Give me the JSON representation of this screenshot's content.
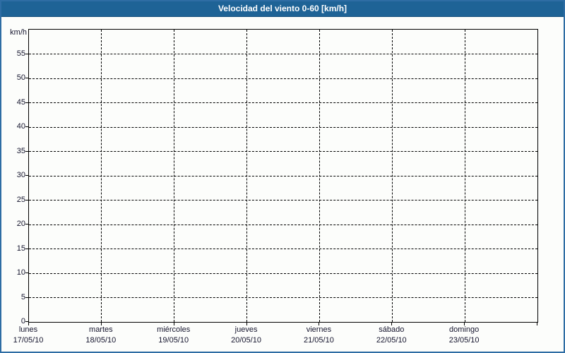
{
  "window": {
    "title": "Velocidad del viento 0-60 [km/h]"
  },
  "colors": {
    "header_bg": "#1E6396",
    "header_edge": "#15507C",
    "frame_border": "#2E6DA4",
    "page_bg": "#FCFDFB",
    "plot_border": "#000000",
    "grid_color": "#000000",
    "text_color": "#14142D",
    "title_text": "#FFFFFF"
  },
  "chart_data": {
    "type": "line",
    "title": "Velocidad del viento 0-60 [km/h]",
    "unit_label": "km/h",
    "ylim": [
      0,
      60
    ],
    "ytick_step": 5,
    "yticks": [
      0,
      5,
      10,
      15,
      20,
      25,
      30,
      35,
      40,
      45,
      50,
      55
    ],
    "x_categories": [
      {
        "day": "lunes",
        "date": "17/05/10"
      },
      {
        "day": "martes",
        "date": "18/05/10"
      },
      {
        "day": "miércoles",
        "date": "19/05/10"
      },
      {
        "day": "jueves",
        "date": "20/05/10"
      },
      {
        "day": "viernes",
        "date": "21/05/10"
      },
      {
        "day": "sábado",
        "date": "22/05/10"
      },
      {
        "day": "domingo",
        "date": "23/05/10"
      }
    ],
    "x_divisions": 7,
    "series": [],
    "grid": "dashed",
    "legend": "none"
  }
}
